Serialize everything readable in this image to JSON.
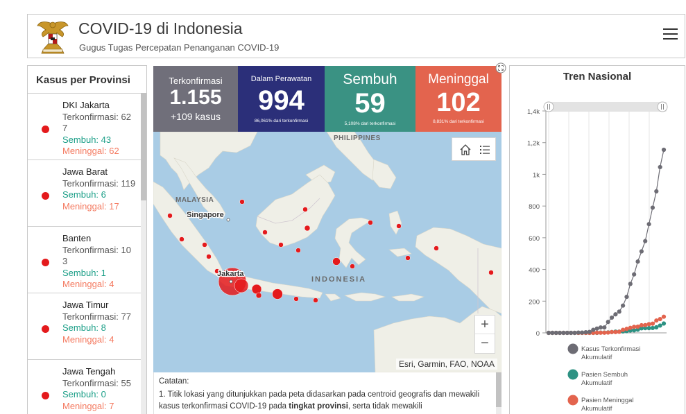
{
  "header": {
    "title": "COVID-19 di Indonesia",
    "subtitle": "Gugus Tugas Percepatan Penanganan COVID-19"
  },
  "colors": {
    "confirmed": "#706f7a",
    "treated": "#2b2f79",
    "recovered": "#3a9283",
    "death": "#e3644e",
    "marker": "#e41a1c",
    "recovered_text": "#1a9e87",
    "death_text": "#f4795f"
  },
  "provinces": {
    "title": "Kasus per Provinsi",
    "items": [
      {
        "name": "DKI Jakarta",
        "confirmed": "Terkonfirmasi: 627",
        "recovered": "Sembuh: 43",
        "deaths": "Meninggal: 62"
      },
      {
        "name": "Jawa Barat",
        "confirmed": "Terkonfirmasi: 119",
        "recovered": "Sembuh: 6",
        "deaths": "Meninggal: 17"
      },
      {
        "name": "Banten",
        "confirmed": "Terkonfirmasi: 103",
        "recovered": "Sembuh: 1",
        "deaths": "Meninggal: 4"
      },
      {
        "name": "Jawa Timur",
        "confirmed": "Terkonfirmasi: 77",
        "recovered": "Sembuh: 8",
        "deaths": "Meninggal: 4"
      },
      {
        "name": "Jawa Tengah",
        "confirmed": "Terkonfirmasi: 55",
        "recovered": "Sembuh: 0",
        "deaths": "Meninggal: 7"
      }
    ]
  },
  "indicators": {
    "confirmed": {
      "label": "Terkonfirmasi",
      "value": "1.155",
      "delta": "+109 kasus"
    },
    "treated": {
      "label": "Dalam Perawatan",
      "value": "994",
      "note": "86,061% dari terkonfirmasi"
    },
    "recovered": {
      "label": "Sembuh",
      "value": "59",
      "note": "5,108% dari terkonfirmasi"
    },
    "deaths": {
      "label": "Meninggal",
      "value": "102",
      "note": "8,831% dari terkonfirmasi"
    }
  },
  "map": {
    "labels": {
      "philippines": "PHILIPPINES",
      "malaysia": "MALAYSIA",
      "singapore": "Singapore",
      "jakarta": "Jakarta",
      "indonesia": "INDONESIA"
    },
    "attribution": "Esri, Garmin, FAO, NOAA",
    "zoom_in": "+",
    "zoom_out": "−",
    "home_icon": "home-icon",
    "legend_icon": "list-icon"
  },
  "notes": {
    "title": "Catatan:",
    "line_start": "1. Titik lokasi yang ditunjukkan pada peta didasarkan pada centroid geografis dan mewakili kasus terkonfirmasi COVID-19 pada ",
    "bold": "tingkat provinsi",
    "line_end": ", serta tidak mewakili"
  },
  "trend": {
    "title": "Tren Nasional"
  },
  "chart_data": {
    "type": "line",
    "title": "Tren Nasional",
    "xlabel": "",
    "ylabel": "",
    "ylim": [
      0,
      1400
    ],
    "yticks": [
      0,
      200,
      400,
      600,
      800,
      1000,
      1200,
      1400
    ],
    "ytick_labels": [
      "0",
      "200",
      "400",
      "600",
      "800",
      "1k",
      "1,2k",
      "1,4k"
    ],
    "grid": true,
    "legend_position": "bottom",
    "series": [
      {
        "name": "Kasus Terkonfirmasi Akumulatif",
        "color": "#6d6c74",
        "values": [
          0,
          0,
          0,
          0,
          0,
          0,
          0,
          0,
          2,
          2,
          4,
          6,
          19,
          27,
          34,
          34,
          69,
          96,
          117,
          134,
          172,
          227,
          309,
          369,
          450,
          514,
          579,
          686,
          790,
          893,
          1046,
          1155
        ]
      },
      {
        "name": "Pasien Sembuh Akumulatif",
        "color": "#2e9283",
        "values": [
          0,
          0,
          0,
          0,
          0,
          0,
          0,
          0,
          0,
          0,
          0,
          0,
          0,
          0,
          2,
          2,
          3,
          5,
          8,
          8,
          9,
          11,
          15,
          16,
          20,
          29,
          30,
          30,
          31,
          35,
          46,
          59
        ]
      },
      {
        "name": "Pasien Meninggal Akumulatif",
        "color": "#e3644e",
        "values": [
          0,
          0,
          0,
          0,
          0,
          0,
          0,
          0,
          0,
          0,
          0,
          0,
          0,
          1,
          1,
          1,
          2,
          5,
          5,
          7,
          19,
          25,
          32,
          38,
          39,
          48,
          49,
          55,
          58,
          78,
          87,
          102
        ]
      }
    ]
  }
}
